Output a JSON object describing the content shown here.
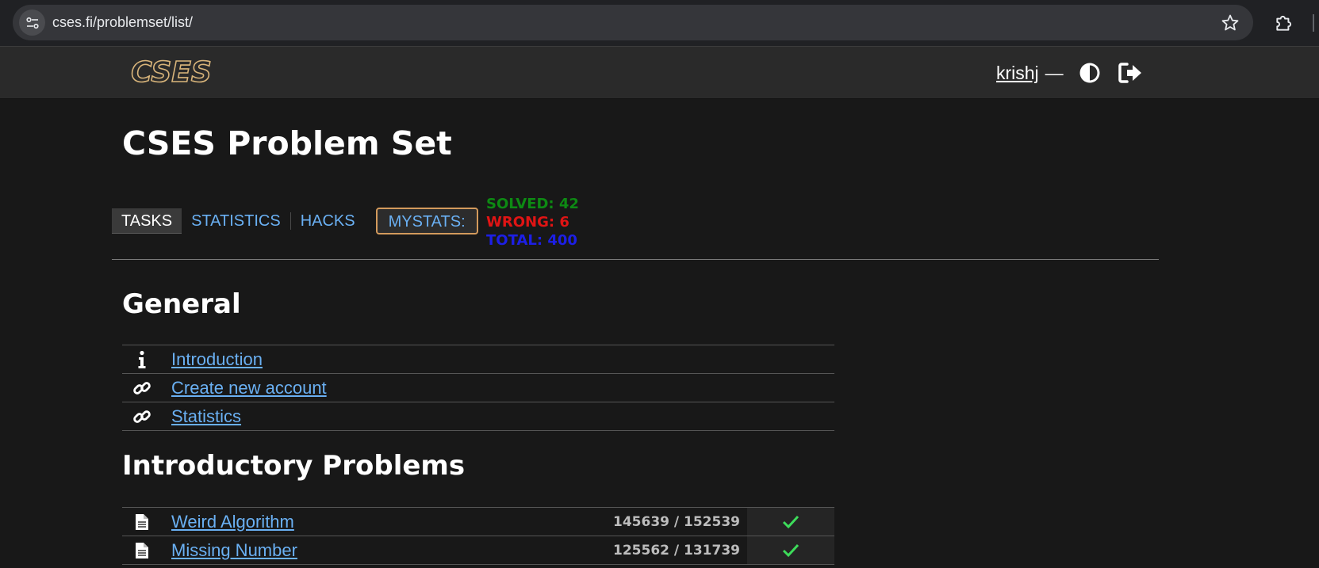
{
  "browser": {
    "url": "cses.fi/problemset/list/",
    "site_info_icon": "tune-icon",
    "bookmark_icon": "star-outline-icon",
    "extensions_icon": "puzzle-icon"
  },
  "header": {
    "logo_text": "CSES",
    "username": "krishj",
    "separator": "—",
    "theme_icon": "contrast-icon",
    "logout_icon": "logout-icon"
  },
  "page": {
    "title": "CSES Problem Set"
  },
  "tabs": [
    {
      "label": "TASKS",
      "active": true
    },
    {
      "label": "STATISTICS",
      "active": false
    },
    {
      "label": "HACKS",
      "active": false
    }
  ],
  "mystats": {
    "label": "MYSTATS:",
    "solved": "SOLVED: 42",
    "wrong": "WRONG: 6",
    "total": "TOTAL: 400"
  },
  "colors": {
    "link": "#6ab0f3",
    "solved": "#0d8a13",
    "wrong": "#e01414",
    "total": "#1d1fe6",
    "check": "#3ddc5a",
    "mystats_border": "#d39a5c",
    "background": "#181818"
  },
  "sections": [
    {
      "title": "General",
      "items": [
        {
          "icon": "info-icon",
          "label": "Introduction"
        },
        {
          "icon": "link-icon",
          "label": "Create new account"
        },
        {
          "icon": "link-icon",
          "label": "Statistics"
        }
      ]
    },
    {
      "title": "Introductory Problems",
      "items": [
        {
          "icon": "document-icon",
          "label": "Weird Algorithm",
          "detail": "145639 / 152539",
          "status": "solved"
        },
        {
          "icon": "document-icon",
          "label": "Missing Number",
          "detail": "125562 / 131739",
          "status": "solved"
        }
      ]
    }
  ]
}
